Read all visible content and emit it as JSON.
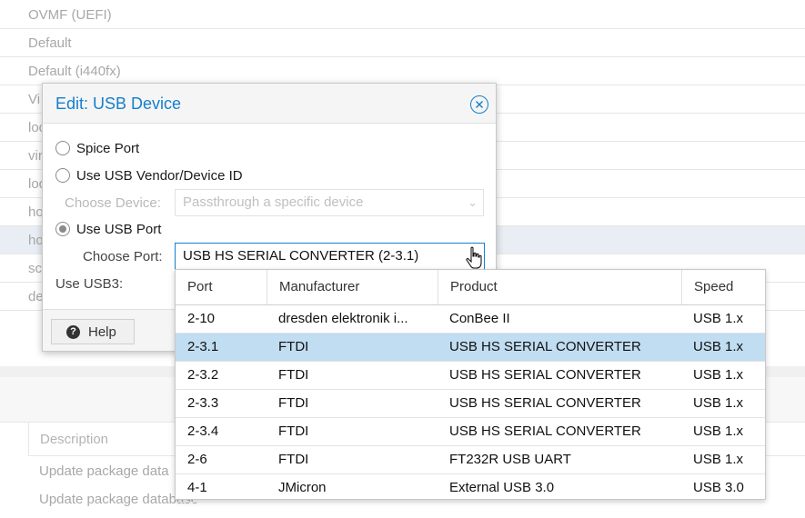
{
  "background": {
    "rows": [
      "OVMF (UEFI)",
      "Default",
      "Default (i440fx)",
      "Vi",
      "loc",
      "vir",
      "loc",
      "ho",
      "ho",
      "sc",
      "de"
    ],
    "description_header": "Description",
    "task_rows": [
      "Update package data",
      "Update package database"
    ]
  },
  "dialog": {
    "title": "Edit: USB Device",
    "close_icon": "close-circle-icon",
    "options": {
      "spice_port": "Spice Port",
      "vendor_device": "Use USB Vendor/Device ID",
      "usb_port": "Use USB Port"
    },
    "selected_option": "usb_port",
    "choose_device_label": "Choose Device:",
    "choose_device_placeholder": "Passthrough a specific device",
    "choose_port_label": "Choose Port:",
    "choose_port_value": "USB HS SERIAL CONVERTER (2-3.1)",
    "use_usb3_label": "Use USB3:",
    "help_label": "Help",
    "help_icon": "question-circle-icon"
  },
  "port_picker": {
    "columns": [
      "Port",
      "Manufacturer",
      "Product",
      "Speed"
    ],
    "rows": [
      {
        "port": "2-10",
        "manufacturer": "dresden elektronik i...",
        "product": "ConBee II",
        "speed": "USB 1.x"
      },
      {
        "port": "2-3.1",
        "manufacturer": "FTDI",
        "product": "USB HS SERIAL CONVERTER",
        "speed": "USB 1.x"
      },
      {
        "port": "2-3.2",
        "manufacturer": "FTDI",
        "product": "USB HS SERIAL CONVERTER",
        "speed": "USB 1.x"
      },
      {
        "port": "2-3.3",
        "manufacturer": "FTDI",
        "product": "USB HS SERIAL CONVERTER",
        "speed": "USB 1.x"
      },
      {
        "port": "2-3.4",
        "manufacturer": "FTDI",
        "product": "USB HS SERIAL CONVERTER",
        "speed": "USB 1.x"
      },
      {
        "port": "2-6",
        "manufacturer": "FTDI",
        "product": "FT232R USB UART",
        "speed": "USB 1.x"
      },
      {
        "port": "4-1",
        "manufacturer": "JMicron",
        "product": "External USB 3.0",
        "speed": "USB 3.0"
      }
    ],
    "selected_port": "2-3.1"
  },
  "colors": {
    "accent": "#157fcc",
    "selected_row": "#c1ddf1"
  }
}
